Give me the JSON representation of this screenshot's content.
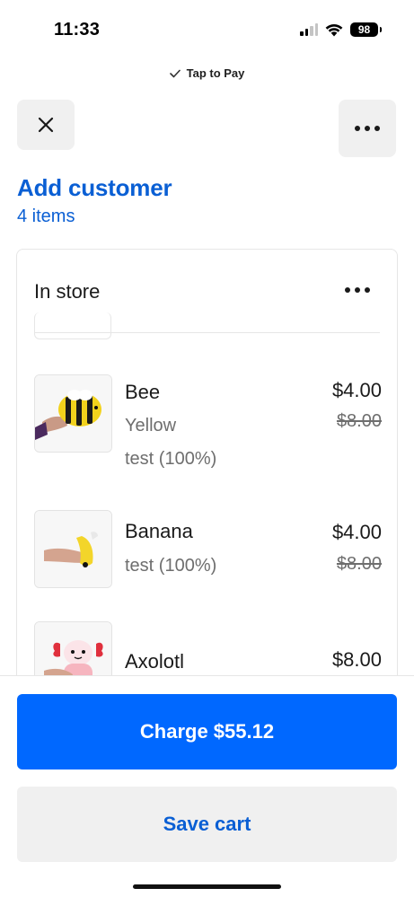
{
  "status_bar": {
    "time": "11:33",
    "battery": "98"
  },
  "header": {
    "tap_to_pay_label": "Tap to Pay"
  },
  "customer": {
    "add_customer_label": "Add customer",
    "items_count": "4 items"
  },
  "cart": {
    "title": "In store",
    "items": [
      {
        "name": "Bee",
        "variant": "Yellow",
        "discount": "test (100%)",
        "price": "$4.00",
        "original_price": "$8.00",
        "thumbnail": "bee-plush-image"
      },
      {
        "name": "Banana",
        "discount": "test (100%)",
        "price": "$4.00",
        "original_price": "$8.00",
        "thumbnail": "banana-plush-image"
      },
      {
        "name": "Axolotl",
        "price": "$8.00",
        "thumbnail": "axolotl-plush-image"
      }
    ]
  },
  "actions": {
    "charge_label": "Charge $55.12",
    "save_cart_label": "Save cart"
  },
  "colors": {
    "primary_blue": "#0068ff",
    "link_blue": "#0a5fd4",
    "button_gray": "#f0f0f0"
  }
}
